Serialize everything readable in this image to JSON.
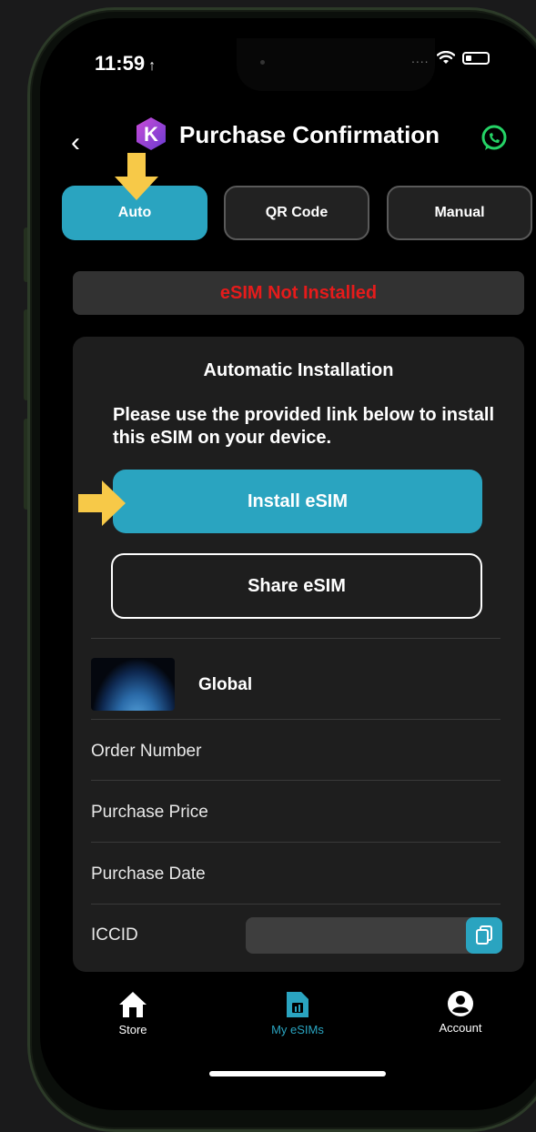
{
  "status_bar": {
    "time": "11:59",
    "time_suffix": "↑",
    "signal": "....",
    "icons": [
      "wifi-icon",
      "battery-icon"
    ]
  },
  "header": {
    "back_label": "‹",
    "logo_letter": "K",
    "title": "Purchase Confirmation",
    "right_icon": "whatsapp-icon"
  },
  "tabs": [
    {
      "label": "Auto",
      "active": true
    },
    {
      "label": "QR Code",
      "active": false
    },
    {
      "label": "Manual",
      "active": false
    }
  ],
  "install_status": "eSIM Not Installed",
  "installation": {
    "title": "Automatic Installation",
    "instructions": "Please use the provided link below to install this eSIM on your device.",
    "install_button": "Install eSIM",
    "share_button": "Share eSIM"
  },
  "plan": {
    "name": "Global"
  },
  "details": {
    "order_number_label": "Order Number",
    "purchase_price_label": "Purchase Price",
    "purchase_date_label": "Purchase Date",
    "iccid_label": "ICCID"
  },
  "bottom_nav": [
    {
      "label": "Store",
      "icon": "home-icon",
      "active": false
    },
    {
      "label": "My eSIMs",
      "icon": "sim-card-icon",
      "active": true
    },
    {
      "label": "Account",
      "icon": "account-icon",
      "active": false
    }
  ],
  "colors": {
    "accent": "#2aa4c0",
    "error": "#e61b1b",
    "highlight_arrow": "#f7c948",
    "background": "#000000",
    "card": "#1e1e1e"
  }
}
